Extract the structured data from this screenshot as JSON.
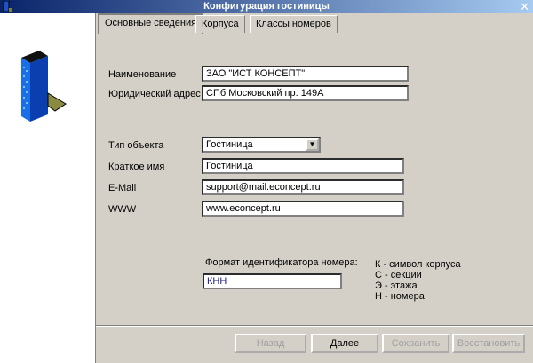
{
  "window": {
    "title": "Конфигурация гостиницы"
  },
  "tabs": [
    {
      "label": "Основные сведения",
      "active": true
    },
    {
      "label": "Корпуса"
    },
    {
      "label": "Классы номеров"
    }
  ],
  "form": {
    "name_label": "Наименование",
    "name_value": "ЗАО \"ИСТ КОНСЕПТ\"",
    "address_label": "Юридический адрес",
    "address_value": "СПб Московский пр. 149А",
    "type_label": "Тип объекта",
    "type_value": "Гостиница",
    "short_label": "Краткое имя",
    "short_value": "Гостиница",
    "email_label": "E-Mail",
    "email_value": "support@mail.econcept.ru",
    "www_label": "WWW",
    "www_value": "www.econcept.ru",
    "format_label": "Формат идентификатора номера:",
    "format_value": "КНН"
  },
  "legend": [
    "К - символ корпуса",
    "С - секции",
    "Э - этажа",
    "Н - номера"
  ],
  "buttons": {
    "back": "Назад",
    "next": "Далее",
    "save": "Сохранить",
    "restore": "Восстановить"
  }
}
